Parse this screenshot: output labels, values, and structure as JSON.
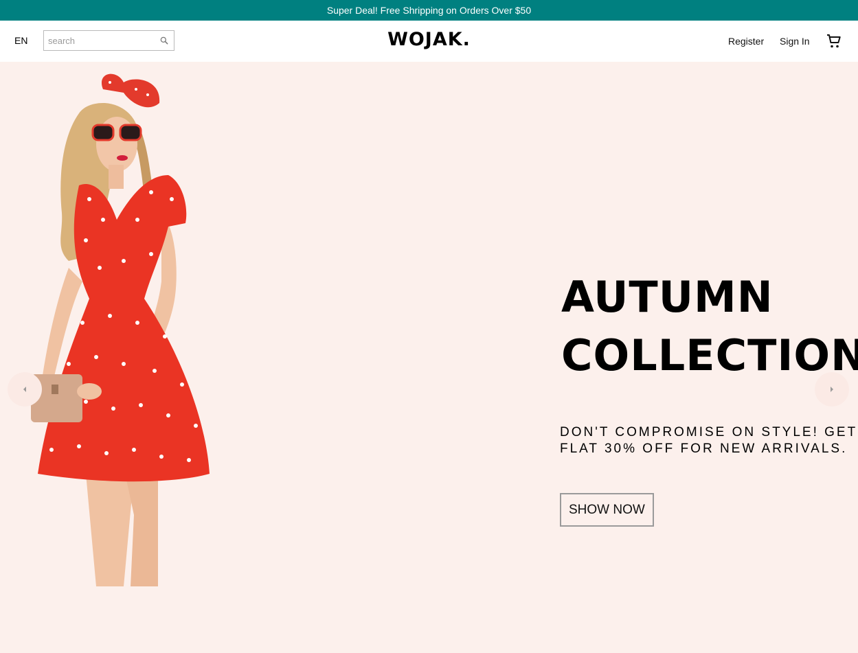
{
  "announcement": {
    "text": "Super Deal! Free Shripping on Orders Over $50"
  },
  "navbar": {
    "language": "EN",
    "search": {
      "placeholder": "search",
      "value": ""
    },
    "logo": "WOJAK.",
    "register_label": "Register",
    "signin_label": "Sign In",
    "cart_icon": "shopping-cart-icon"
  },
  "hero": {
    "title": "AUTUMN\nCOLLECTION",
    "description": "DON'T COMPROMISE ON STYLE! GET FLAT 30% OFF FOR NEW ARRIVALS.",
    "button_label": "SHOW NOW",
    "image": "model-in-red-polka-dot-dress",
    "background_color": "#fcf0ec"
  },
  "colors": {
    "accent": "#008080"
  }
}
